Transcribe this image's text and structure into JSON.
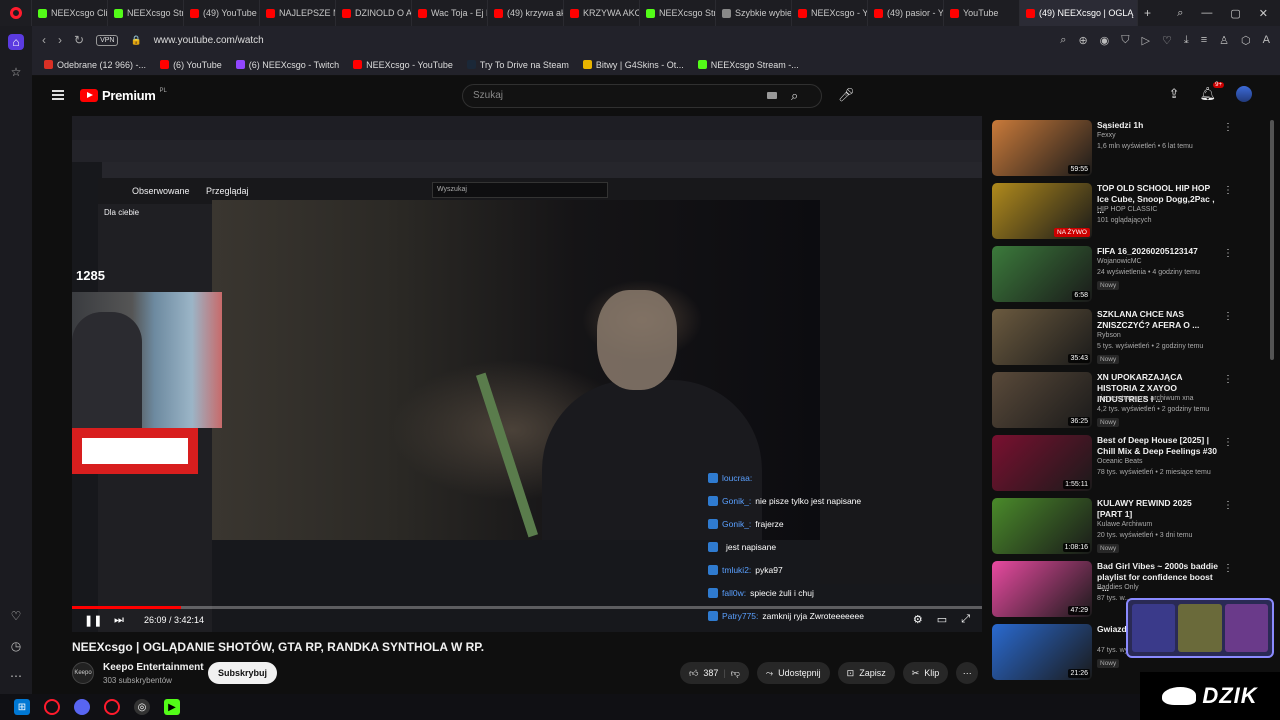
{
  "browser": {
    "tabs": [
      {
        "label": "NEEXcsgo Clip",
        "color": "#53fc18"
      },
      {
        "label": "NEEXcsgo Strea",
        "color": "#53fc18"
      },
      {
        "label": "(49) YouTube",
        "color": "#ff0000"
      },
      {
        "label": "NAJLEPSZE MC",
        "color": "#ff0000"
      },
      {
        "label": "DZINOLD O AU",
        "color": "#ff0000"
      },
      {
        "label": "Wac Toja - Ej D",
        "color": "#ff0000"
      },
      {
        "label": "(49) krzywa akc",
        "color": "#ff0000"
      },
      {
        "label": "KRZYWA AKCJA",
        "color": "#ff0000"
      },
      {
        "label": "NEEXcsgo Stre",
        "color": "#53fc18"
      },
      {
        "label": "Szybkie wybier",
        "color": "#888888"
      },
      {
        "label": "NEEXcsgo - Yo",
        "color": "#ff0000"
      },
      {
        "label": "(49) pasior - Yo",
        "color": "#ff0000"
      },
      {
        "label": "YouTube",
        "color": "#ff0000"
      },
      {
        "label": "(49) NEEXcsgo | OGLĄ",
        "color": "#ff0000",
        "active": true
      }
    ],
    "url": "www.youtube.com/watch",
    "vpn_label": "VPN",
    "bookmarks": [
      {
        "label": "Odebrane (12 966) -...",
        "color": "#d93025"
      },
      {
        "label": "(6) YouTube",
        "color": "#ff0000"
      },
      {
        "label": "(6) NEEXcsgo - Twitch",
        "color": "#9146ff"
      },
      {
        "label": "NEEXcsgo - YouTube",
        "color": "#ff0000"
      },
      {
        "label": "Try To Drive na Steam",
        "color": "#1b2838"
      },
      {
        "label": "Bitwy | G4Skins - Ot...",
        "color": "#e8b400"
      },
      {
        "label": "NEEXcsgo Stream -...",
        "color": "#53fc18"
      }
    ]
  },
  "youtube": {
    "logo_text": "Premium",
    "region": "PL",
    "search_placeholder": "Szukaj",
    "notifications_badge": "9+"
  },
  "video": {
    "viewers_overlay": "1285",
    "twitch_nav": [
      "Obserwowane",
      "Przeglądaj"
    ],
    "twitch_search": "Wyszukaj",
    "sidebar_title": "Dla ciebie",
    "chat_lines": [
      {
        "user": "loucraa:",
        "msg": ""
      },
      {
        "user": "Gonik_:",
        "msg": "nie pisze tylko jest napisane"
      },
      {
        "user": "Gonik_:",
        "msg": "frajerze"
      },
      {
        "user": "",
        "msg": "jest napisane"
      },
      {
        "user": "tmluki2:",
        "msg": "pyka97"
      },
      {
        "user": "fall0w:",
        "msg": "spiecie żuli i chuj"
      },
      {
        "user": "Patry775:",
        "msg": "zamknij ryja Zwroteeeeeee"
      }
    ],
    "time": "26:09 / 3:42:14",
    "progress": 0.12
  },
  "meta": {
    "title": "NEEXcsgo | OGLĄDANIE SHOTÓW, GTA RP, RANDKA SYNTHOLA W RP.",
    "channel": "Keepo Entertainment",
    "channel_avatar_text": "Keepo",
    "subs": "303 subskrybentów",
    "subscribe": "Subskrybuj",
    "likes": "387",
    "share": "Udostępnij",
    "save": "Zapisz",
    "clip": "Klip"
  },
  "recommendations": [
    {
      "title": "Sąsiedzi 1h",
      "channel": "Fexxy",
      "meta": "1,6 mln wyświetleń • 6 lat temu",
      "duration": "59:55",
      "new": false,
      "thumb": "#c97a3a"
    },
    {
      "title": "TOP OLD SCHOOL HIP HOP Ice Cube, Snoop Dogg,2Pac , ...",
      "channel": "HIP HOP CLASSIC",
      "meta": "101 oglądających",
      "live": "NA ŻYWO",
      "new": false,
      "thumb": "#b08a1c"
    },
    {
      "title": "FIFA 16_20260205123147",
      "channel": "WojanowicMC",
      "meta": "24 wyświetlenia • 4 godziny temu",
      "duration": "6:58",
      "new": true,
      "thumb": "#3b7a3b"
    },
    {
      "title": "SZKLANA CHCE NAS ZNISZCZYĆ? AFERA O ...",
      "channel": "Rybson",
      "meta": "5 tys. wyświetleń • 2 godziny temu",
      "duration": "35:43",
      "new": true,
      "thumb": "#6b5a3f"
    },
    {
      "title": "XN UPOKARZAJĄCA HISTORIA Z XAYOO INDUSTRIES I ...",
      "channel": "niemerytoryczne archiwum xna",
      "meta": "4,2 tys. wyświetleń • 2 godziny temu",
      "duration": "36:25",
      "new": true,
      "thumb": "#5a4a3a"
    },
    {
      "title": "Best of Deep House [2025] | Chill Mix & Deep Feelings #30",
      "channel": "Oceanic Beats",
      "meta": "78 tys. wyświetleń • 2 miesiące temu",
      "duration": "1:55:11",
      "new": false,
      "thumb": "#7a1030"
    },
    {
      "title": "KULAWY REWIND 2025 [PART 1]",
      "channel": "Kulawe Archiwum",
      "meta": "20 tys. wyświetleń • 3 dni temu",
      "duration": "1:08:16",
      "new": true,
      "thumb": "#4a8a2a"
    },
    {
      "title": "Bad Girl Vibes ~ 2000s baddie playlist for confidence boost ~...",
      "channel": "Baddies Only",
      "meta": "87 tys. w...",
      "duration": "47:29",
      "new": false,
      "thumb": "#e84aa0"
    },
    {
      "title": "Gwiazd... CHALL...",
      "channel": "",
      "meta": "47 tys. wyświetleń • 1 dzień temu",
      "duration": "21:26",
      "new": true,
      "thumb": "#2a6ad0"
    }
  ],
  "overlay": {
    "brand": "DZIK"
  }
}
